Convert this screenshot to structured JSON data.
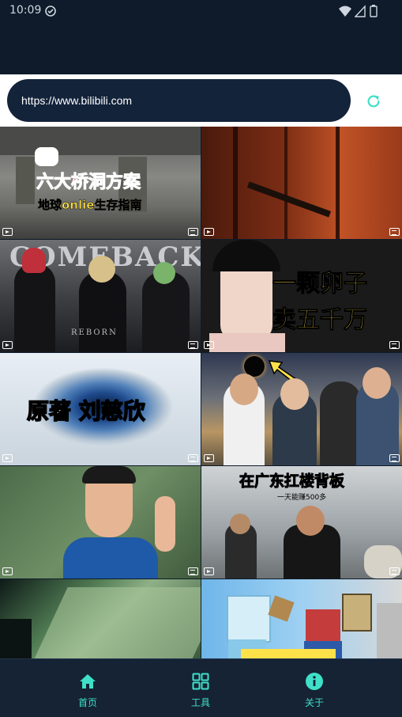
{
  "status_bar": {
    "time": "10:09"
  },
  "browser": {
    "url": "https://www.bilibili.com"
  },
  "videos": [
    {
      "title_line1": "六大桥洞方案",
      "title_line2": "地球onlie生存指南"
    },
    {},
    {
      "title": "COMEBACK",
      "sub": "REBORN"
    },
    {
      "title_line1": "一颗卵子",
      "title_line2": "卖五千万"
    },
    {
      "title": "原著 刘慈欣"
    },
    {},
    {},
    {
      "title_line1": "在广东扛楼背板",
      "title_line2": "一天能赚500多"
    },
    {},
    {}
  ],
  "nav": [
    {
      "label": "首页",
      "icon": "home-icon"
    },
    {
      "label": "工具",
      "icon": "grid-icon"
    },
    {
      "label": "关于",
      "icon": "info-icon"
    }
  ],
  "colors": {
    "accent": "#3fe0c8",
    "background": "#0f1b2a"
  }
}
